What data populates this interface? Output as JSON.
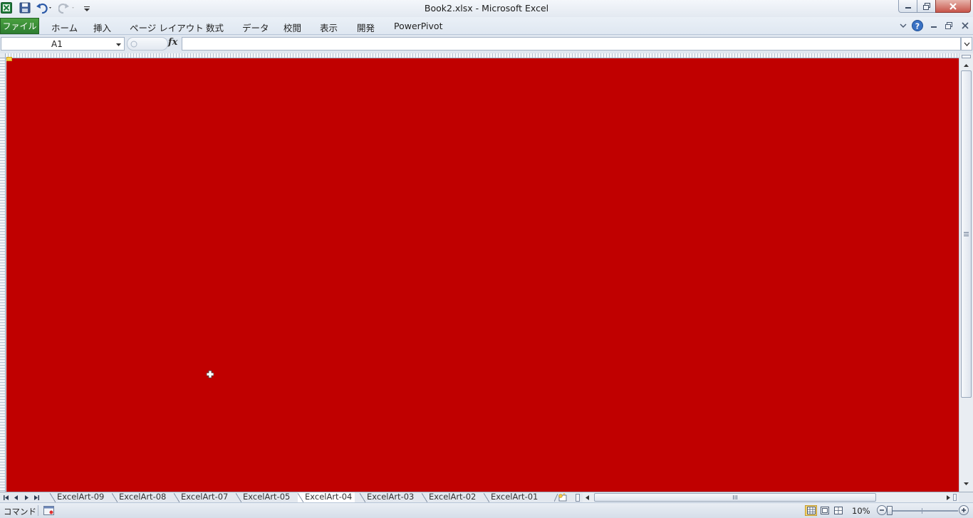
{
  "window": {
    "title": "Book2.xlsx  -  Microsoft Excel"
  },
  "ribbon": {
    "file_tab": "ファイル",
    "tabs": [
      "ホーム",
      "挿入",
      "ページ レイアウト",
      "数式",
      "データ",
      "校閲",
      "表示",
      "開発",
      "PowerPivot"
    ]
  },
  "formula_bar": {
    "name_box": "A1",
    "formula": "",
    "fx_label": "fx"
  },
  "sheet": {
    "fill_color": "#C00000"
  },
  "sheet_tabs": {
    "tabs": [
      "ExcelArt-09",
      "ExcelArt-08",
      "ExcelArt-07",
      "ExcelArt-05",
      "ExcelArt-04",
      "ExcelArt-03",
      "ExcelArt-02",
      "ExcelArt-01"
    ],
    "active": "ExcelArt-04"
  },
  "status_bar": {
    "mode": "コマンド",
    "zoom": "10%",
    "active_view": "normal"
  },
  "icons": {
    "app": "excel-app-icon",
    "save": "save-icon",
    "undo": "undo-icon",
    "redo": "redo-icon",
    "help": "help-icon"
  }
}
